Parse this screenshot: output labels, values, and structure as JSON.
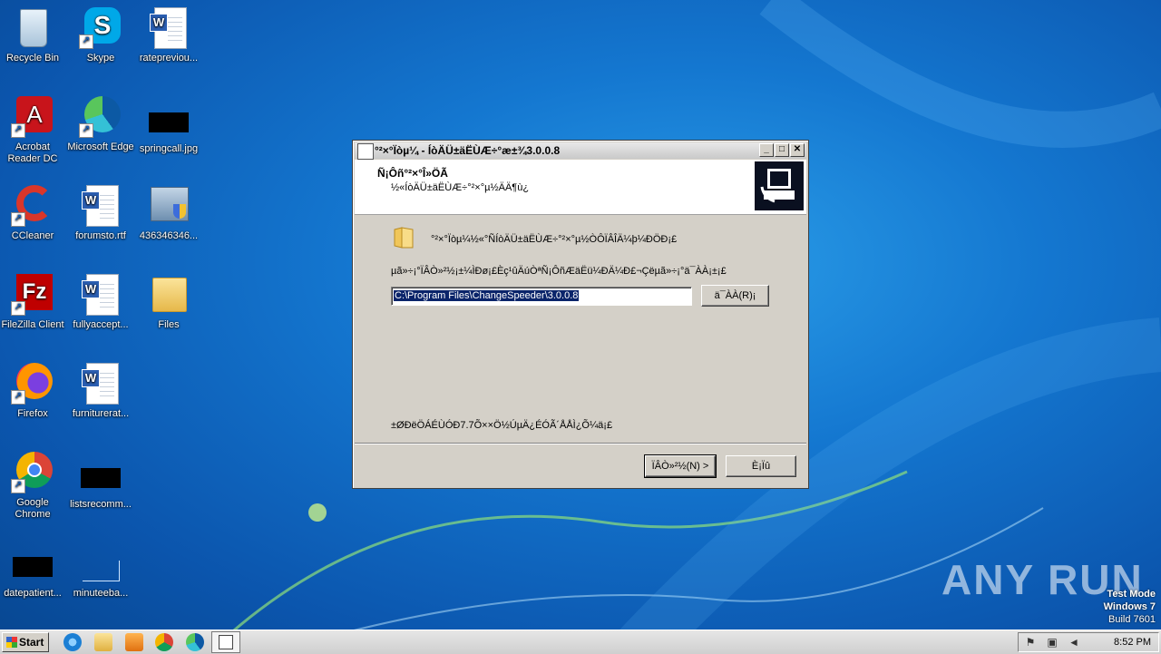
{
  "desktop": {
    "icons": [
      {
        "label": "Recycle Bin"
      },
      {
        "label": "Skype"
      },
      {
        "label": "ratepreviou..."
      },
      {
        "label": "Acrobat Reader DC"
      },
      {
        "label": "Microsoft Edge"
      },
      {
        "label": "springcall.jpg"
      },
      {
        "label": "CCleaner"
      },
      {
        "label": "forumsto.rtf"
      },
      {
        "label": "436346346..."
      },
      {
        "label": "FileZilla Client"
      },
      {
        "label": "fullyaccept..."
      },
      {
        "label": "Files"
      },
      {
        "label": "Firefox"
      },
      {
        "label": "furniturerat..."
      },
      {
        "label": "Google Chrome"
      },
      {
        "label": "listsrecomm..."
      },
      {
        "label": "datepatient..."
      },
      {
        "label": "minuteeba..."
      }
    ]
  },
  "dialog": {
    "title": "°²×°Ïòµ¼ - ÍòÄÜ±äËÙÆ÷°æ±¾3.0.0.8",
    "header_title": "Ñ¡Ôñ°²×°Î»ÖÃ",
    "header_subtitle": "½«ÍòÄÜ±äËÙÆ÷°²×°µ½ÄÄ¶ù¿",
    "line1": "°²×°Ïòµ¼½«°ÑÍòÄÜ±äËÙÆ÷°²×°µ½ÒÔÏÂÎÄ¼þ¼ÐÖÐ¡£",
    "line2": "µã»÷¡°ÏÂÒ»²½¡±¼ÌÐø¡£Èç¹ûÄúÒªÑ¡ÔñÆäËü¼ÐÄ¼Ð£¬Çëµã»÷¡°ä¯ÀÀ¡±¡£",
    "path_value": "C:\\Program Files\\ChangeSpeeder\\3.0.0.8",
    "browse_label": "ä¯ÀÀ(R)¡­",
    "disk_note": "±ØÐëÖÁÉÙÓÐ7.7Õ××Ö½ÚµÄ¿ÉÓÃ´ÅÅÌ¿Õ¼ä¡£",
    "next_label": "ÏÂÒ»²½(N) >",
    "cancel_label": "È¡Ïû"
  },
  "watermark": {
    "text": "ANY RUN",
    "test_mode": "Test Mode",
    "os": "Windows 7",
    "build": "Build 7601"
  },
  "taskbar": {
    "start_label": "Start",
    "clock": "8:52 PM"
  },
  "colors": {
    "desktop_bg": "#1477d0",
    "dialog_bg": "#d4d0c8",
    "selection": "#0a246a"
  }
}
